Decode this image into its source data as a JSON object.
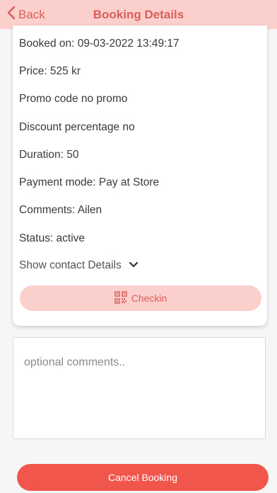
{
  "header": {
    "back_label": "Back",
    "title": "Booking Details"
  },
  "details": {
    "booked_on": "Booked on: 09-03-2022 13:49:17",
    "price": "Price: 525 kr",
    "promo_code": "Promo code no promo",
    "discount": "Discount percentage no",
    "duration": "Duration: 50",
    "payment_mode": "Payment mode: Pay at Store",
    "comments": "Comments: Ailen",
    "status": "Status: active"
  },
  "contact_toggle_label": "Show contact Details",
  "checkin_label": "Checkin",
  "comments_input": {
    "value": "",
    "placeholder": "optional comments.."
  },
  "cancel_label": "Cancel Booking",
  "colors": {
    "header_bg": "#fbcfcb",
    "accent": "#d9605a",
    "cancel_bg": "#f0564b"
  },
  "icons": {
    "back": "chevron-left-icon",
    "contact_toggle": "chevron-down-icon",
    "checkin": "qr-code-icon"
  }
}
